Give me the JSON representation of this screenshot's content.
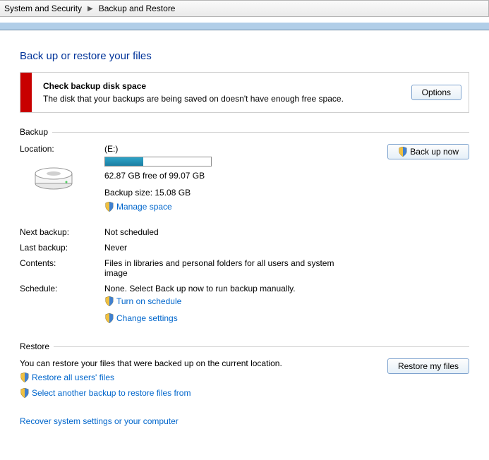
{
  "breadcrumb": {
    "parent": "System and Security",
    "current": "Backup and Restore"
  },
  "page_title": "Back up or restore your files",
  "alert": {
    "title": "Check backup disk space",
    "message": "The disk that your backups are being saved on doesn't have enough free space.",
    "button": "Options"
  },
  "backup": {
    "section": "Backup",
    "location_label": "Location:",
    "drive": "(E:)",
    "space_text": "62.87 GB free of 99.07 GB",
    "backup_size_text": "Backup size: 15.08 GB",
    "manage_space": "Manage space",
    "backup_now_button": "Back up now",
    "rows": {
      "next_label": "Next backup:",
      "next_value": "Not scheduled",
      "last_label": "Last backup:",
      "last_value": "Never",
      "contents_label": "Contents:",
      "contents_value": "Files in libraries and personal folders for all users and system image",
      "schedule_label": "Schedule:",
      "schedule_value": "None. Select Back up now to run backup manually.",
      "turn_on_schedule": "Turn on schedule",
      "change_settings": "Change settings"
    }
  },
  "restore": {
    "section": "Restore",
    "text": "You can restore your files that were backed up on the current location.",
    "restore_all": "Restore all users' files",
    "select_another": "Select another backup to restore files from",
    "button": "Restore my files"
  },
  "recover_link": "Recover system settings or your computer"
}
